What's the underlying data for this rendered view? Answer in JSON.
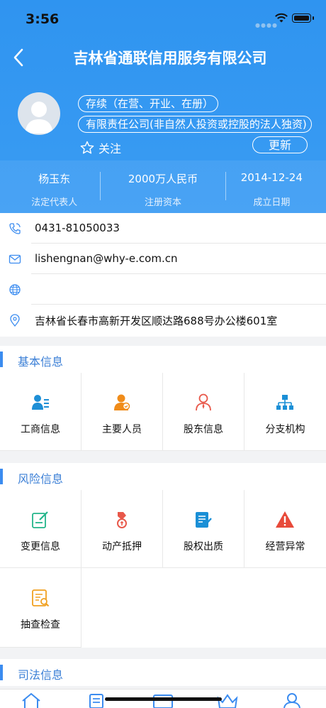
{
  "status_bar": {
    "time": "3:56"
  },
  "header": {
    "title": "吉林省通联信用服务有限公司",
    "status_tag": "存续（在营、开业、在册）",
    "type_tag": "有限责任公司(非自然人投资或控股的法人独资)",
    "follow_label": "关注",
    "update_label": "更新"
  },
  "stats": [
    {
      "value": "杨玉东",
      "label": "法定代表人"
    },
    {
      "value": "2000万人民币",
      "label": "注册资本"
    },
    {
      "value": "2014-12-24",
      "label": "成立日期"
    }
  ],
  "contacts": {
    "phone": "0431-81050033",
    "email": "lishengnan@why-e.com.cn",
    "website": "",
    "address": "吉林省长春市高新开发区顺达路688号办公楼601室"
  },
  "sections": {
    "basic": {
      "title": "基本信息",
      "items": [
        {
          "label": "工商信息",
          "icon": "business-info-icon",
          "color": "#1e8fd6"
        },
        {
          "label": "主要人员",
          "icon": "key-personnel-icon",
          "color": "#f08c1a"
        },
        {
          "label": "股东信息",
          "icon": "shareholder-icon",
          "color": "#e8584a"
        },
        {
          "label": "分支机构",
          "icon": "branch-icon",
          "color": "#1a8fd6"
        }
      ]
    },
    "risk": {
      "title": "风险信息",
      "items": [
        {
          "label": "变更信息",
          "icon": "change-info-icon",
          "color": "#22b58a"
        },
        {
          "label": "动产抵押",
          "icon": "chattel-mortgage-icon",
          "color": "#e8584a"
        },
        {
          "label": "股权出质",
          "icon": "equity-pledge-icon",
          "color": "#1a8fd6"
        },
        {
          "label": "经营异常",
          "icon": "warning-icon",
          "color": "#e84a3a"
        },
        {
          "label": "抽查检查",
          "icon": "inspection-icon",
          "color": "#f0a020"
        }
      ]
    },
    "judicial": {
      "title": "司法信息"
    }
  },
  "colors": {
    "header_blue": "#3a9cf3",
    "accent": "#3b8cf0"
  }
}
